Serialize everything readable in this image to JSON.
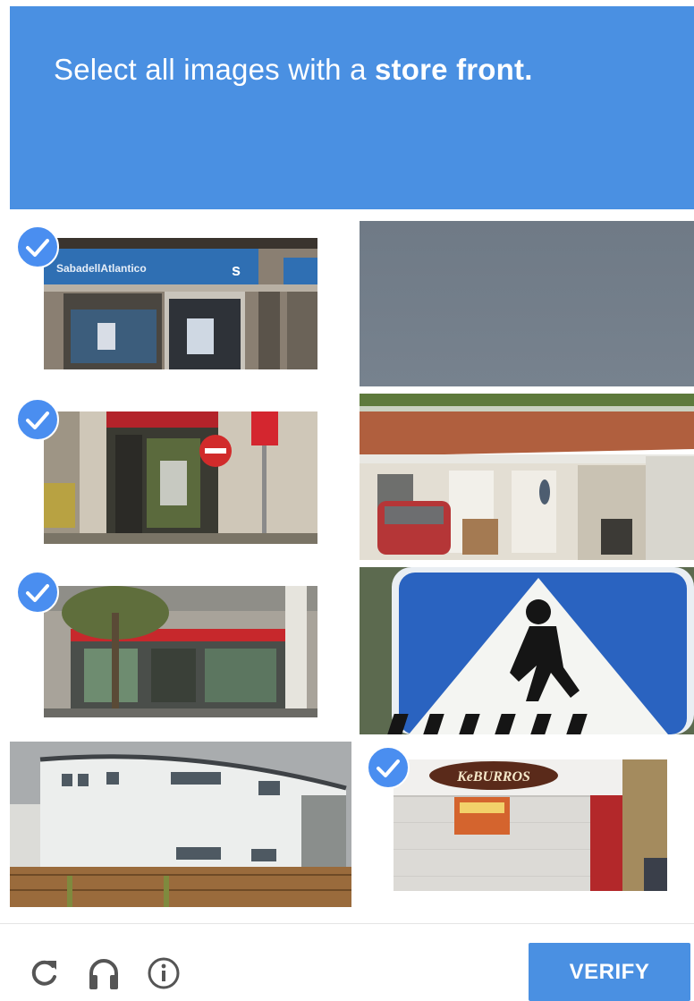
{
  "header": {
    "instruction_prefix": "Select all images with a ",
    "instruction_target": "store front.",
    "background_color": "#4a90e2"
  },
  "tiles": [
    {
      "label": "store-front-bank",
      "selected": true,
      "sign_text": "SabadellAtlantico"
    },
    {
      "label": "empty-gray-sky",
      "selected": false
    },
    {
      "label": "store-front-shop-entrance",
      "selected": true
    },
    {
      "label": "white-house-with-car",
      "selected": false
    },
    {
      "label": "store-front-row",
      "selected": true
    },
    {
      "label": "pedestrian-crossing-sign",
      "selected": false
    },
    {
      "label": "white-building",
      "selected": false
    },
    {
      "label": "store-front-shutter",
      "selected": true,
      "sign_text": "KeBURROS"
    }
  ],
  "footer": {
    "reload_icon": "reload-icon",
    "audio_icon": "headphones-icon",
    "info_icon": "info-icon",
    "verify_label": "VERIFY",
    "accent_color": "#4a90e2"
  }
}
